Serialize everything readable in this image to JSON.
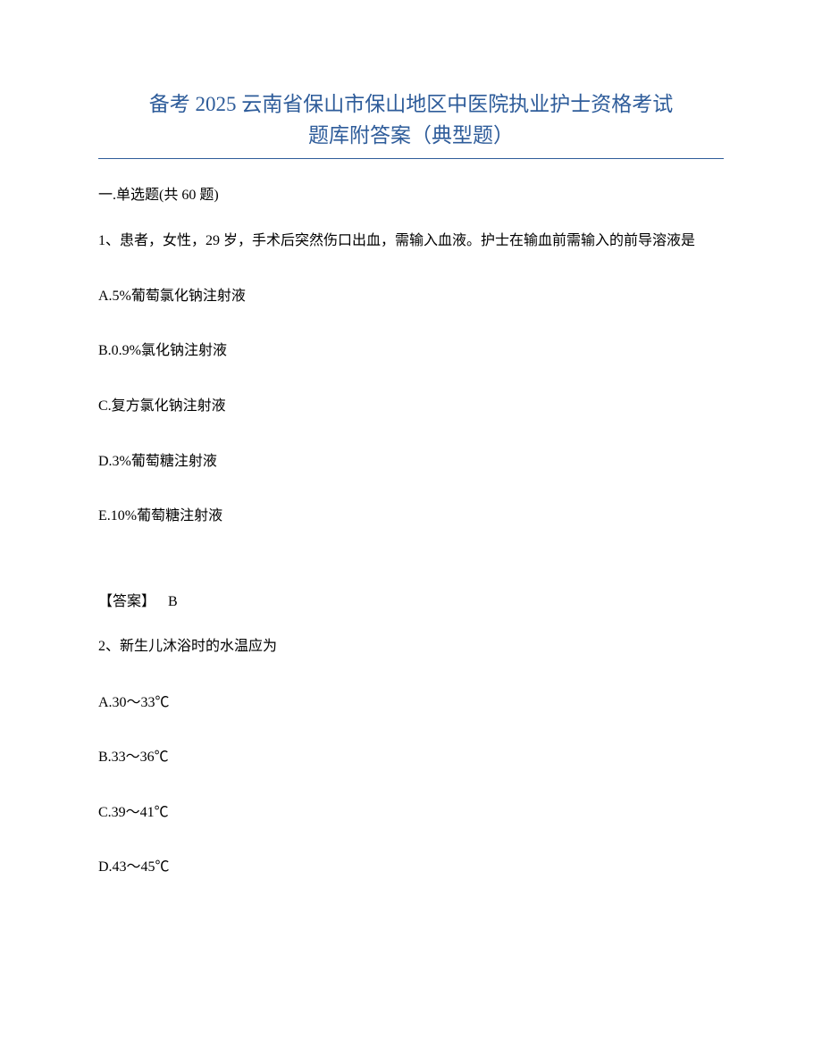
{
  "title": {
    "line1": "备考 2025 云南省保山市保山地区中医院执业护士资格考试",
    "line2": "题库附答案（典型题）"
  },
  "section_header": "一.单选题(共 60 题)",
  "questions": [
    {
      "stem": "1、患者，女性，29 岁，手术后突然伤口出血，需输入血液。护士在输血前需输入的前导溶液是",
      "options": {
        "A": "A.5%葡萄氯化钠注射液",
        "B": "B.0.9%氯化钠注射液",
        "C": "C.复方氯化钠注射液",
        "D": "D.3%葡萄糖注射液",
        "E": "E.10%葡萄糖注射液"
      },
      "answer_label": "【答案】",
      "answer_value": "B"
    },
    {
      "stem": "2、新生儿沐浴时的水温应为",
      "options": {
        "A": "A.30～33℃",
        "B": "B.33～36℃",
        "C": "C.39～41℃",
        "D": "D.43～45℃"
      }
    }
  ]
}
